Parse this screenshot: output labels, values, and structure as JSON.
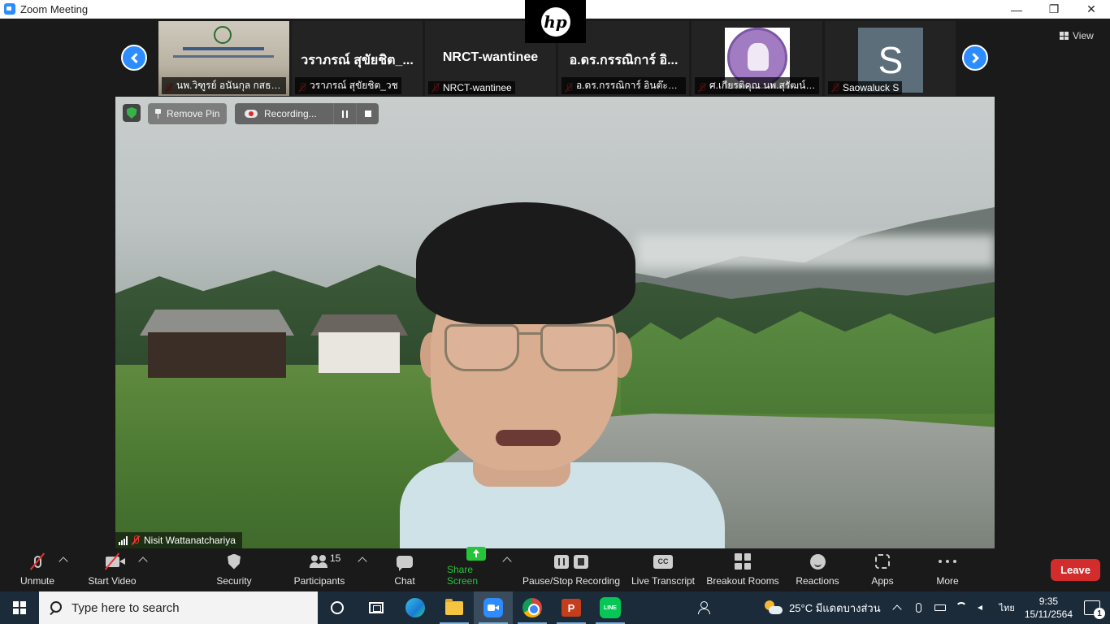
{
  "window": {
    "title": "Zoom Meeting",
    "minimize": "—",
    "restore": "❐",
    "close": "✕"
  },
  "camera_notch": {
    "brand": "hp"
  },
  "gallery": {
    "view_label": "View",
    "tiles": [
      {
        "display_name": "",
        "label": "นพ.วิฑูรย์ อนันกุล กสธฉ...",
        "kind": "photo"
      },
      {
        "display_name": "วราภรณ์ สุขัยชิต_...",
        "label": "วราภรณ์ สุขัยชิต_วช",
        "kind": "name"
      },
      {
        "display_name": "NRCT-wantinee",
        "label": "NRCT-wantinee",
        "kind": "name"
      },
      {
        "display_name": "อ.ดร.กรรณิการ์ อิ...",
        "label": "อ.ดร.กรรณิการ์ อินต๊ะวงศ์",
        "kind": "name"
      },
      {
        "display_name": "",
        "label": "ศ.เกียรติคุณ นพ.สุรัฒน์ จ...",
        "kind": "logo"
      },
      {
        "display_name": "",
        "label": "Saowaluck S",
        "kind": "avatar",
        "avatar_letter": "S"
      }
    ]
  },
  "video": {
    "remove_pin_label": "Remove Pin",
    "recording_label": "Recording...",
    "speaker_name": "Nisit Wattanatchariya"
  },
  "toolbar": {
    "unmute": "Unmute",
    "start_video": "Start Video",
    "security": "Security",
    "participants": "Participants",
    "participants_count": "15",
    "chat": "Chat",
    "share_screen": "Share Screen",
    "pause_stop_recording": "Pause/Stop Recording",
    "cc_glyph": "CC",
    "live_transcript": "Live Transcript",
    "breakout_rooms": "Breakout Rooms",
    "reactions": "Reactions",
    "apps": "Apps",
    "more": "More",
    "leave": "Leave"
  },
  "taskbar": {
    "search_placeholder": "Type here to search",
    "ppt_glyph": "P",
    "line_glyph": "LINE",
    "weather": "25°C  มีแดดบางส่วน",
    "language": "ไทย",
    "time": "9:35",
    "date": "15/11/2564",
    "notification_count": "1"
  },
  "colors": {
    "zoom_blue": "#2d8cff",
    "leave_red": "#d32c2c",
    "share_green": "#25c43a",
    "taskbar": "#1c2b3a"
  }
}
